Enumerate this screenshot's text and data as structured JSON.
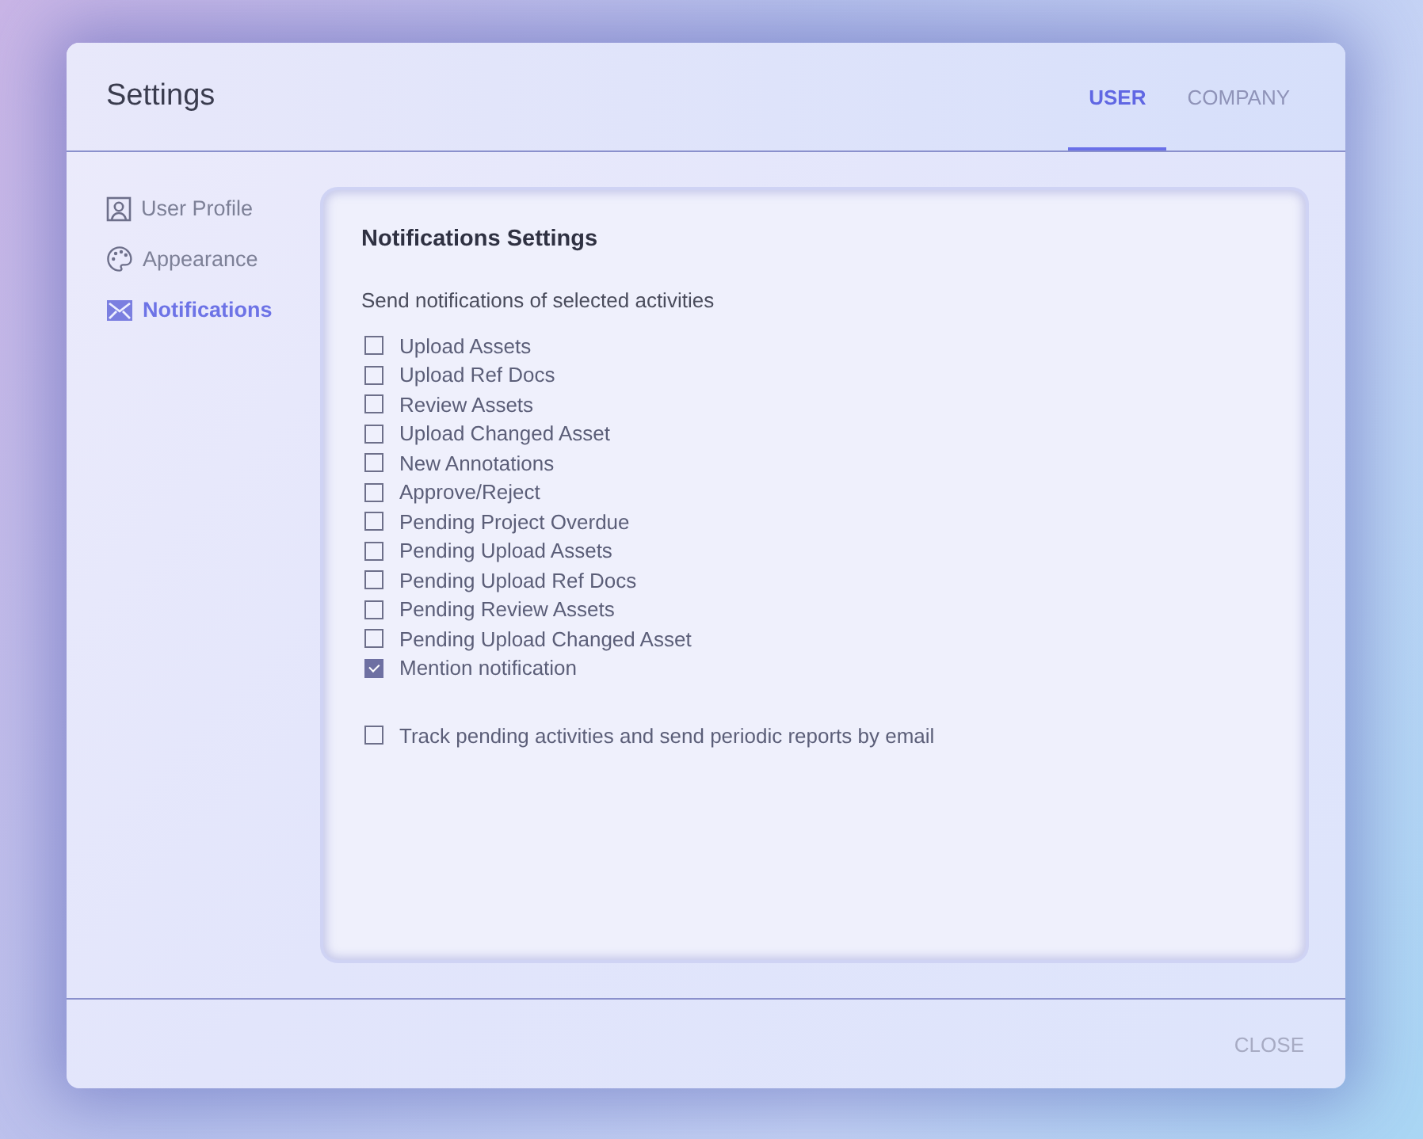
{
  "window": {
    "title": "Settings"
  },
  "tabs": [
    {
      "label": "USER",
      "selected": true
    },
    {
      "label": "COMPANY",
      "selected": false
    }
  ],
  "sidebar": {
    "items": [
      {
        "label": "User Profile",
        "kind": "profile",
        "selected": false
      },
      {
        "label": "Appearance",
        "kind": "palette",
        "selected": false
      },
      {
        "label": "Notifications",
        "kind": "mail",
        "selected": true
      }
    ]
  },
  "panel": {
    "title": "Notifications Settings",
    "subtitle": "Send notifications of selected activities",
    "activities": [
      {
        "label": "Upload Assets",
        "checked": false
      },
      {
        "label": "Upload Ref Docs",
        "checked": false
      },
      {
        "label": "Review Assets",
        "checked": false
      },
      {
        "label": "Upload Changed Asset",
        "checked": false
      },
      {
        "label": "New Annotations",
        "checked": false
      },
      {
        "label": "Approve/Reject",
        "checked": false
      },
      {
        "label": "Pending Project Overdue",
        "checked": false
      },
      {
        "label": "Pending Upload Assets",
        "checked": false
      },
      {
        "label": "Pending Upload Ref Docs",
        "checked": false
      },
      {
        "label": "Pending Review Assets",
        "checked": false
      },
      {
        "label": "Pending Upload Changed Asset",
        "checked": false
      },
      {
        "label": "Mention notification",
        "checked": true
      }
    ],
    "report": {
      "label": "Track pending activities and send periodic reports by email",
      "checked": false
    }
  },
  "footer": {
    "close_button": "CLOSE"
  }
}
